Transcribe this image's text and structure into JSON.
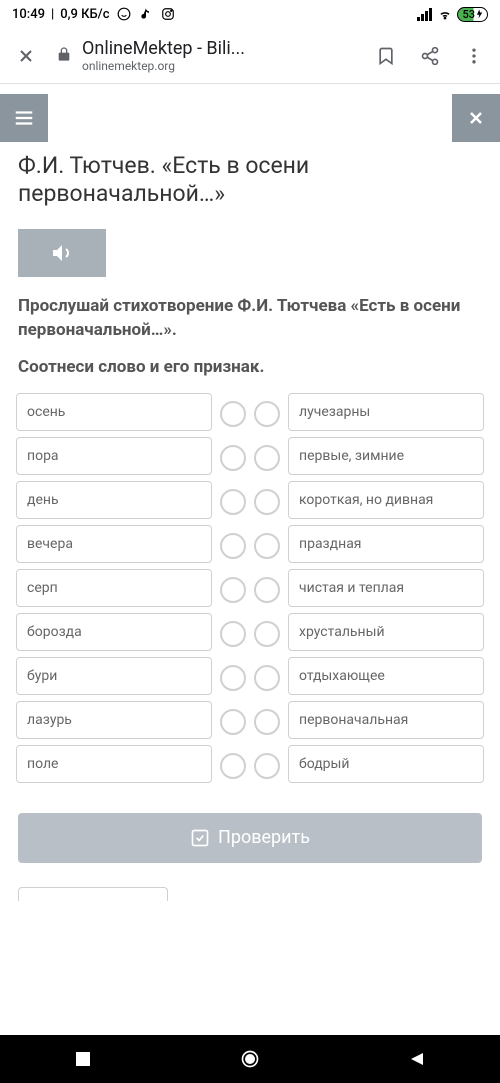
{
  "status": {
    "time": "10:49",
    "data": "0,9 КБ/с",
    "battery": "53"
  },
  "browser": {
    "title": "OnlineMektep - Bili...",
    "domain": "onlinemektep.org"
  },
  "lesson": {
    "title": "Ф.И. Тютчев. «Есть в осени первоначальной…»",
    "instruction": "Прослушай стихотворение Ф.И. Тютчева «Есть в осени первоначальной…».",
    "task": "Соотнеси слово и его признак."
  },
  "words": [
    "осень",
    "пора",
    "день",
    "вечера",
    "серп",
    "борозда",
    "бури",
    "лазурь",
    "поле"
  ],
  "attributes": [
    "лучезарны",
    "первые, зимние",
    "короткая, но дивная",
    "праздная",
    "чистая и теплая",
    "хрустальный",
    "отдыхающее",
    "первоначальная",
    "бодрый"
  ],
  "check_label": "Проверить"
}
